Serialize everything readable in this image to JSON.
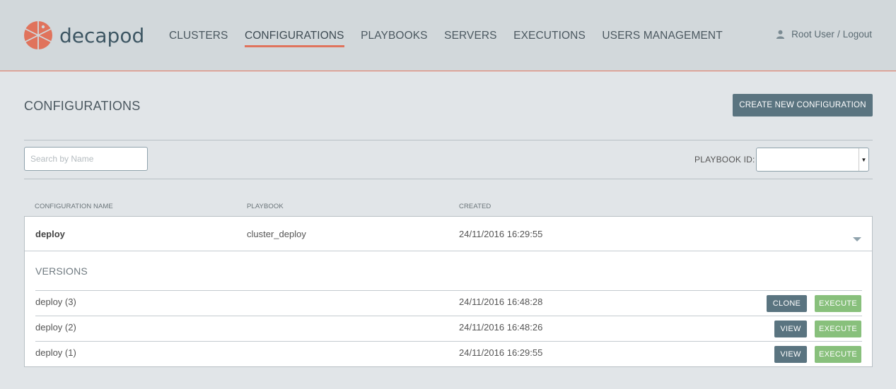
{
  "header": {
    "logo_text": "decapod",
    "nav": [
      {
        "label": "CLUSTERS",
        "active": false
      },
      {
        "label": "CONFIGURATIONS",
        "active": true
      },
      {
        "label": "PLAYBOOKS",
        "active": false
      },
      {
        "label": "SERVERS",
        "active": false
      },
      {
        "label": "EXECUTIONS",
        "active": false
      },
      {
        "label": "USERS MANAGEMENT",
        "active": false
      }
    ],
    "user_name": "Root User",
    "separator": "/",
    "logout_label": "Logout"
  },
  "page": {
    "title": "CONFIGURATIONS",
    "create_button": "CREATE NEW CONFIGURATION"
  },
  "filters": {
    "search_placeholder": "Search by Name",
    "search_value": "",
    "playbook_label": "PLAYBOOK ID:",
    "playbook_value": ""
  },
  "table": {
    "columns": [
      "CONFIGURATION NAME",
      "PLAYBOOK",
      "CREATED"
    ],
    "row": {
      "name": "deploy",
      "playbook": "cluster_deploy",
      "created": "24/11/2016 16:29:55"
    },
    "versions_title": "VERSIONS",
    "versions": [
      {
        "name": "deploy (3)",
        "date": "24/11/2016 16:48:28",
        "primary": "CLONE",
        "secondary": "EXECUTE"
      },
      {
        "name": "deploy (2)",
        "date": "24/11/2016 16:48:26",
        "primary": "VIEW",
        "secondary": "EXECUTE"
      },
      {
        "name": "deploy (1)",
        "date": "24/11/2016 16:29:55",
        "primary": "VIEW",
        "secondary": "EXECUTE"
      }
    ]
  },
  "colors": {
    "accent": "#e0735c",
    "primary_button": "#5a7480",
    "execute_button": "#88c07c"
  }
}
